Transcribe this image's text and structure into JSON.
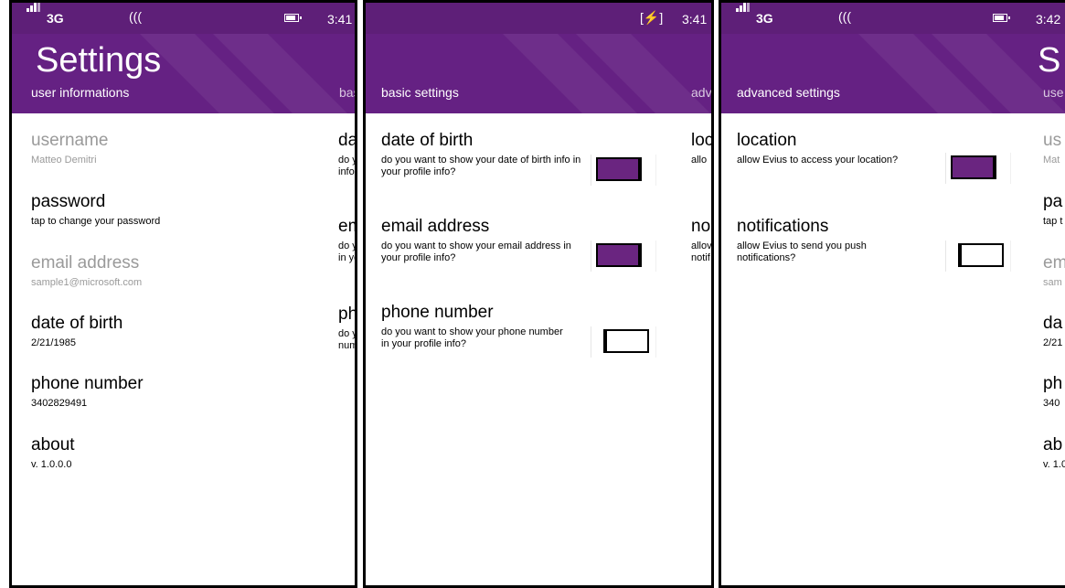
{
  "colors": {
    "accent": "#652183",
    "status_bar": "#5e1f78",
    "dim_text": "#9a9a9a"
  },
  "panel1": {
    "status": {
      "network": "3G",
      "time": "3:41"
    },
    "app_title": "Settings",
    "pivot_current": "user informations",
    "pivot_next": "bas",
    "items": [
      {
        "title": "username",
        "value": "Matteo Demitri"
      },
      {
        "title": "password",
        "value": "tap to change your password"
      },
      {
        "title": "email address",
        "value": "sample1@microsoft.com"
      },
      {
        "title": "date of birth",
        "value": "2/21/1985"
      },
      {
        "title": "phone number",
        "value": "3402829491"
      },
      {
        "title": "about",
        "value": "v. 1.0.0.0"
      }
    ],
    "peek": [
      {
        "title": "da",
        "sub1": "do y",
        "sub2": "info"
      },
      {
        "title": "em",
        "sub1": "do y",
        "sub2": "in yo"
      },
      {
        "title": "ph",
        "sub1": "do y",
        "sub2": "num"
      }
    ]
  },
  "panel2": {
    "status": {
      "time": "3:41"
    },
    "pivot_current": "basic settings",
    "pivot_next": "adv",
    "items": [
      {
        "title": "date of birth",
        "desc": "do you want to show your date of birth info in your profile info?",
        "toggle_on": true
      },
      {
        "title": "email address",
        "desc": "do you want to show your email address in your profile info?",
        "toggle_on": true
      },
      {
        "title": "phone number",
        "desc": "do you want to show your phone number in your profile info?",
        "toggle_on": false
      }
    ],
    "peek": [
      {
        "title": "loc",
        "sub1": "allo",
        "sub2": ""
      },
      {
        "title": "no",
        "sub1": "allov",
        "sub2": "notif"
      }
    ]
  },
  "panel3": {
    "status": {
      "network": "3G",
      "time": "3:42"
    },
    "app_title_peek": "S",
    "pivot_current": "advanced settings",
    "pivot_next": "use",
    "items": [
      {
        "title": "location",
        "desc": "allow Evius to access your location?",
        "toggle_on": true
      },
      {
        "title": "notifications",
        "desc": "allow Evius to send you push notifications?",
        "toggle_on": false
      }
    ],
    "peek": [
      {
        "title": "us",
        "sub": "Mat"
      },
      {
        "title": "pa",
        "sub": "tap t"
      },
      {
        "title": "em",
        "sub": "sam"
      },
      {
        "title": "da",
        "sub": "2/21"
      },
      {
        "title": "ph",
        "sub": "340"
      },
      {
        "title": "ab",
        "sub": "v. 1.0"
      }
    ]
  }
}
